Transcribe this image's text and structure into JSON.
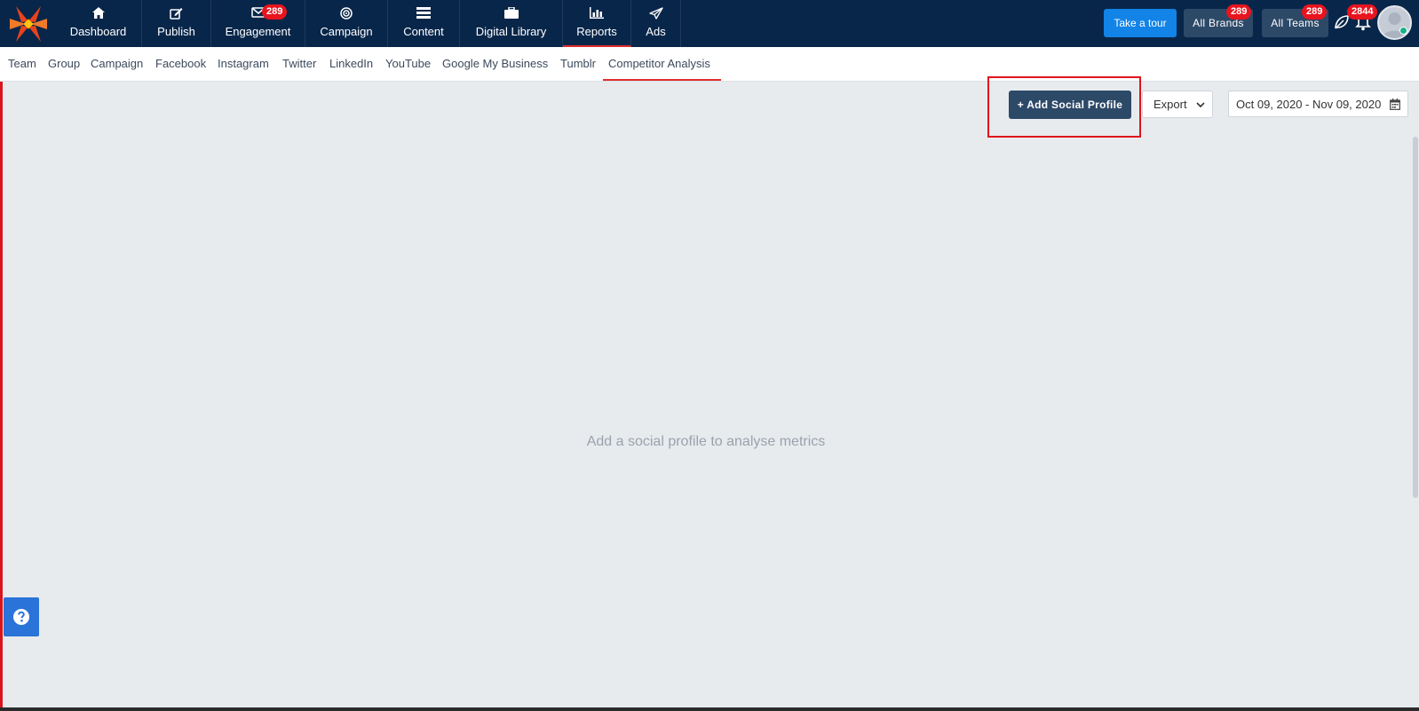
{
  "topnav": {
    "items": [
      {
        "label": "Dashboard",
        "icon": "home-icon"
      },
      {
        "label": "Publish",
        "icon": "edit-icon"
      },
      {
        "label": "Engagement",
        "icon": "envelope-icon",
        "badge": "289"
      },
      {
        "label": "Campaign",
        "icon": "target-icon"
      },
      {
        "label": "Content",
        "icon": "list-icon"
      },
      {
        "label": "Digital Library",
        "icon": "briefcase-icon"
      },
      {
        "label": "Reports",
        "icon": "bar-chart-icon",
        "active": true
      },
      {
        "label": "Ads",
        "icon": "paper-plane-icon"
      }
    ],
    "tour_label": "Take a tour",
    "brands_label": "All Brands",
    "brands_badge": "289",
    "teams_label": "All Teams",
    "teams_badge": "289",
    "notifications_badge": "2844"
  },
  "subnav": {
    "items": [
      "Team",
      "Group",
      "Campaign",
      "Facebook",
      "Instagram",
      "Twitter",
      "LinkedIn",
      "YouTube",
      "Google My Business",
      "Tumblr",
      "Competitor Analysis"
    ],
    "active": "Competitor Analysis"
  },
  "toolbar": {
    "add_profile_label": "+ Add Social Profile",
    "export_label": "Export",
    "date_range": "Oct 09, 2020 - Nov 09, 2020"
  },
  "main": {
    "empty_message": "Add a social profile to analyse metrics"
  },
  "colors": {
    "nav_bg": "#08264a",
    "accent_red": "#e02d2d",
    "tour_blue": "#1283e7",
    "dark_button": "#2d4968",
    "badge_red": "#e8141e",
    "page_bg": "#e8ebee"
  }
}
